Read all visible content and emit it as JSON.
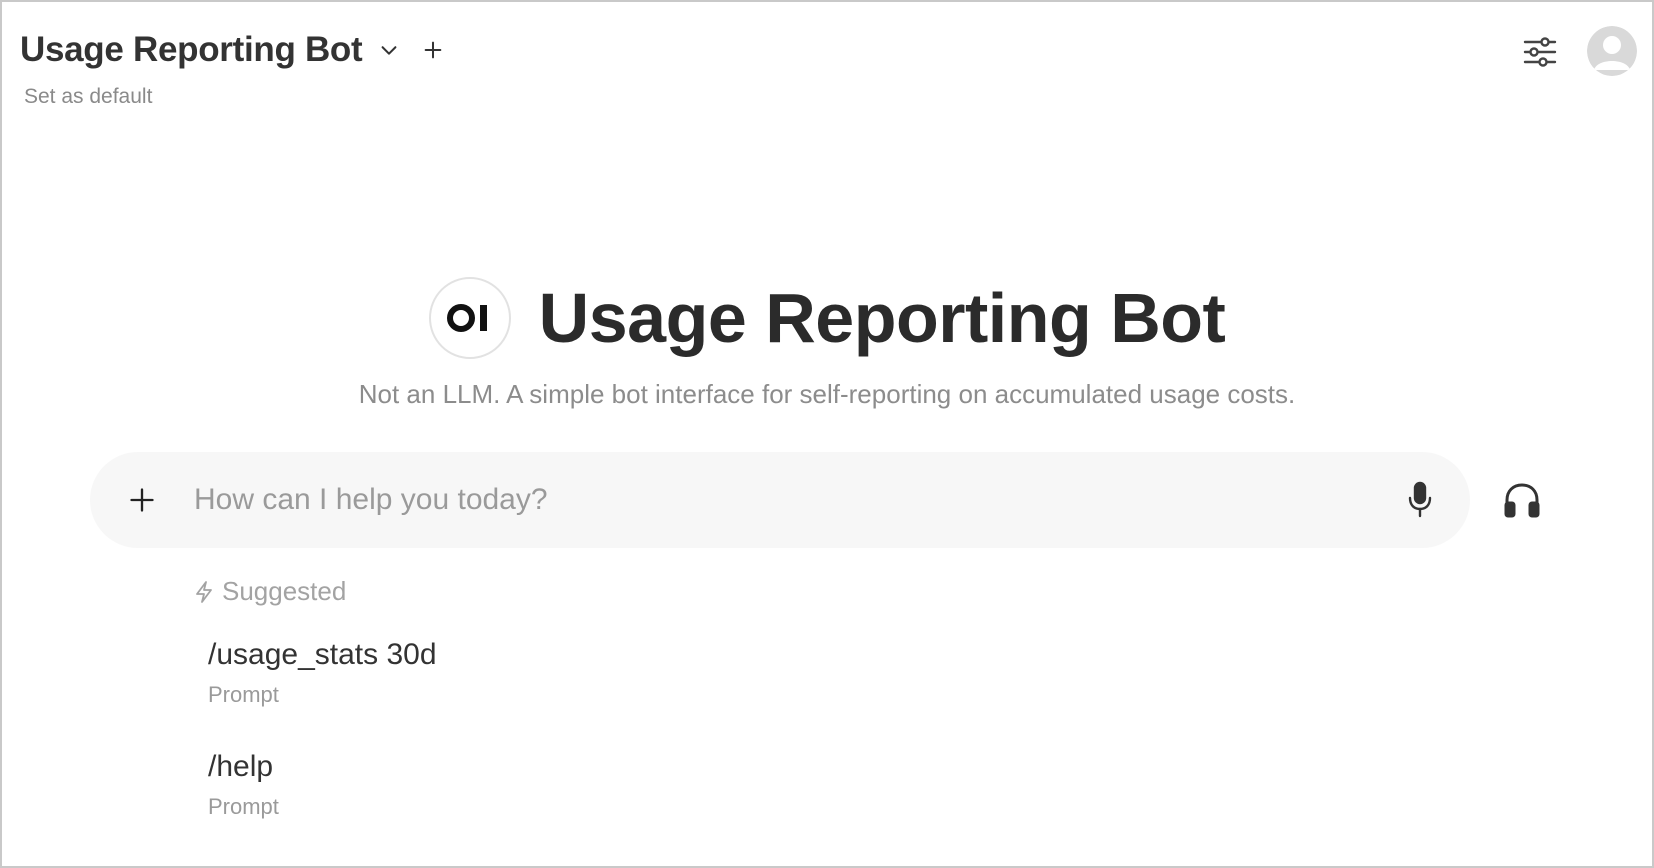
{
  "header": {
    "model_name": "Usage Reporting Bot",
    "set_default": "Set as default",
    "icons": {
      "model_dropdown": "chevron-down-icon",
      "new_model": "plus-icon",
      "controls": "sliders-icon",
      "avatar": "user-avatar-icon"
    }
  },
  "hero": {
    "logo_text": "OI",
    "title": "Usage Reporting Bot",
    "subtitle": "Not an LLM. A simple bot interface for self-reporting on accumulated usage costs."
  },
  "input": {
    "placeholder": "How can I help you today?",
    "value": "",
    "icons": {
      "attach": "plus-icon",
      "mic": "microphone-icon",
      "voice": "headphones-icon"
    }
  },
  "suggested": {
    "heading": "Suggested",
    "icon": "bolt-icon",
    "items": [
      {
        "title": "/usage_stats 30d",
        "subtitle": "Prompt"
      },
      {
        "title": "/help",
        "subtitle": "Prompt"
      }
    ]
  },
  "colors": {
    "text_primary": "#333333",
    "text_muted": "#8c8c8c",
    "input_bg": "#f7f7f7",
    "border": "#c9c9c9"
  }
}
